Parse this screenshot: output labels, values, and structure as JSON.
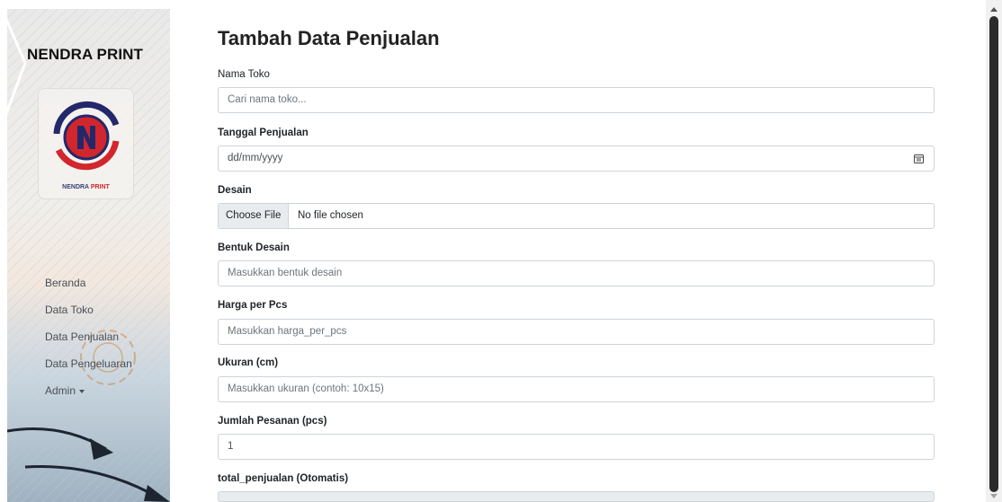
{
  "sidebar": {
    "brand": "NENDRA PRINT",
    "logo_caption_left": "NENDRA",
    "logo_caption_right": "PRINT",
    "nav": [
      {
        "label": "Beranda"
      },
      {
        "label": "Data Toko"
      },
      {
        "label": "Data Penjualan"
      },
      {
        "label": "Data Pengeluaran"
      },
      {
        "label": "Admin"
      }
    ]
  },
  "form": {
    "title": "Tambah Data Penjualan",
    "nama_toko": {
      "label": "Nama Toko",
      "placeholder": "Cari nama toko..."
    },
    "tanggal": {
      "label": "Tanggal Penjualan",
      "value": "dd/mm/yyyy"
    },
    "desain": {
      "label": "Desain",
      "button": "Choose File",
      "status": "No file chosen"
    },
    "bentuk": {
      "label": "Bentuk Desain",
      "placeholder": "Masukkan bentuk desain"
    },
    "harga": {
      "label": "Harga per Pcs",
      "placeholder": "Masukkan harga_per_pcs"
    },
    "ukuran": {
      "label": "Ukuran (cm)",
      "placeholder": "Masukkan ukuran (contoh: 10x15)"
    },
    "jumlah": {
      "label": "Jumlah Pesanan (pcs)",
      "value": "1"
    },
    "total": {
      "label": "total_penjualan (Otomatis)",
      "value": ""
    }
  },
  "colors": {
    "logo_red": "#d1262d",
    "logo_navy": "#23286b",
    "border": "#ced4da"
  },
  "icons": [
    "calendar-icon",
    "caret-down-icon",
    "chevron-icon",
    "gear-icon"
  ]
}
